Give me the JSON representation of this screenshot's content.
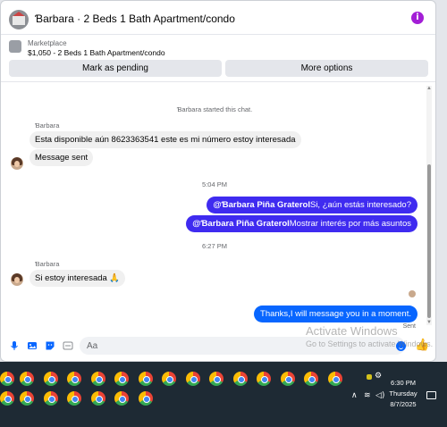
{
  "header": {
    "title": "Ɓarbara · 2 Beds 1 Bath Apartment/condo",
    "info_icon": "info-icon",
    "accent_color": "#a31ed6"
  },
  "listing": {
    "category": "Marketplace",
    "summary": "$1,050 - 2 Beds 1 Bath Apartment/condo"
  },
  "actions": {
    "pending_label": "Mark as pending",
    "more_label": "More options"
  },
  "chat": {
    "started_text": "Ɓarbara started this chat.",
    "messages": [
      {
        "sender": "Ɓarbara",
        "text": "Esta disponible aún 8623363541 este es mi número estoy interesada"
      },
      {
        "text": "Message sent"
      },
      {
        "time": "5:04 PM"
      },
      {
        "mention": "@Ɓarbara Piña Graterol",
        "text": "Si, ¿aún estás interesado?"
      },
      {
        "mention": "@Ɓarbara Piña Graterol",
        "text": "Mostrar interés por más asuntos"
      },
      {
        "time": "6:27 PM"
      },
      {
        "sender": "Ɓarbara",
        "text": "Si estoy interesada 🙏"
      },
      {
        "text": "Thanks,I will message you in a moment.",
        "status": "Sent"
      }
    ],
    "outgoing_color": "#3f2bf0",
    "reply_color": "#0866ff"
  },
  "composer": {
    "placeholder": "Aa",
    "icons": [
      "microphone-icon",
      "photo-icon",
      "sticker-icon",
      "gif-icon",
      "emoji-icon",
      "thumbs-up-icon"
    ]
  },
  "watermark": {
    "line1": "Activate Windows",
    "line2": "Go to Settings to activate Windows."
  },
  "taskbar": {
    "time": "6:30 PM",
    "day": "Thursday",
    "date": "8/7/2025"
  }
}
